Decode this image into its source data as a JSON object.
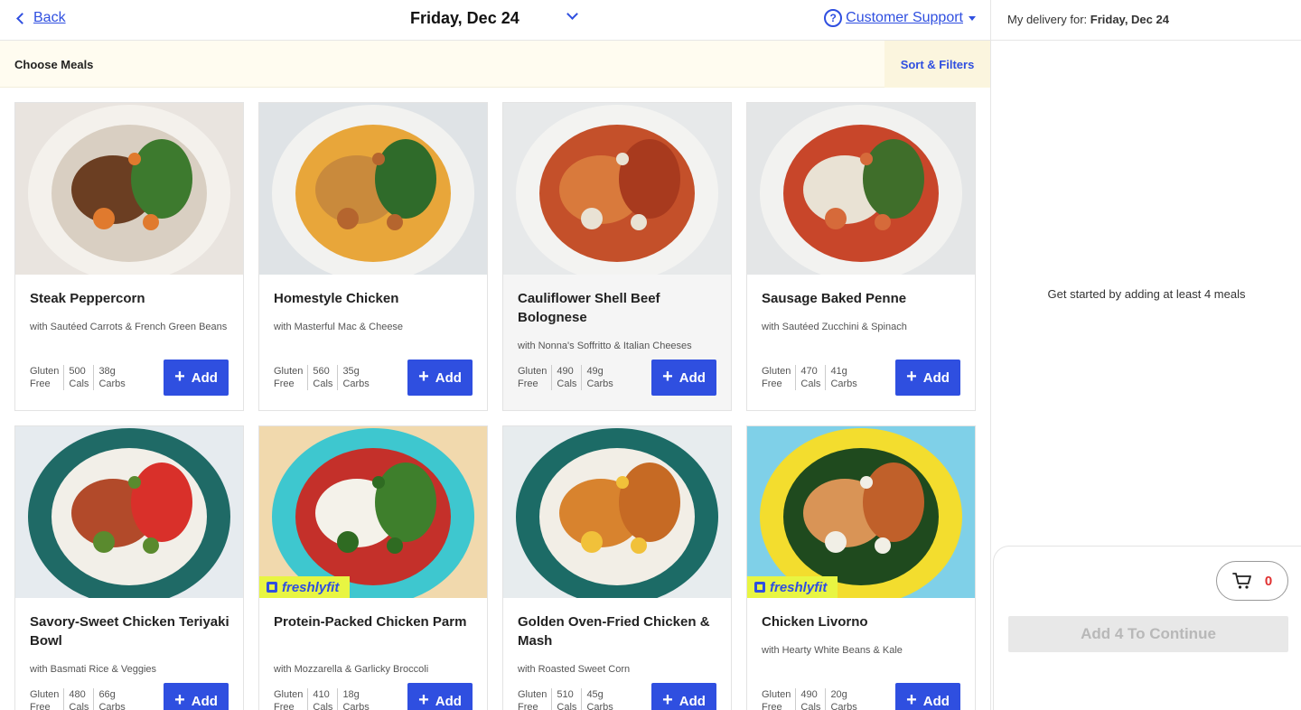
{
  "header": {
    "back_label": "Back",
    "date_label": "Friday, Dec 24",
    "support_label": "Customer Support",
    "support_icon": "?"
  },
  "subbar": {
    "title": "Choose Meals",
    "sort_label": "Sort & Filters"
  },
  "meals": [
    {
      "name": "Steak Peppercorn",
      "sub": "with Sautéed Carrots & French Green Beans",
      "diet": [
        "Gluten",
        "Free"
      ],
      "cals": [
        "500",
        "Cals"
      ],
      "carbs": [
        "38g",
        "Carbs"
      ],
      "add_label": "Add",
      "badge": ""
    },
    {
      "name": "Homestyle Chicken",
      "sub": "with Masterful Mac & Cheese",
      "diet": [
        "Gluten",
        "Free"
      ],
      "cals": [
        "560",
        "Cals"
      ],
      "carbs": [
        "35g",
        "Carbs"
      ],
      "add_label": "Add",
      "badge": ""
    },
    {
      "name": "Cauliflower Shell Beef Bolognese",
      "sub": "with Nonna's Soffritto & Italian Cheeses",
      "diet": [
        "Gluten",
        "Free"
      ],
      "cals": [
        "490",
        "Cals"
      ],
      "carbs": [
        "49g",
        "Carbs"
      ],
      "add_label": "Add",
      "badge": ""
    },
    {
      "name": "Sausage Baked Penne",
      "sub": "with Sautéed Zucchini & Spinach",
      "diet": [
        "Gluten",
        "Free"
      ],
      "cals": [
        "470",
        "Cals"
      ],
      "carbs": [
        "41g",
        "Carbs"
      ],
      "add_label": "Add",
      "badge": ""
    },
    {
      "name": "Savory-Sweet Chicken Teriyaki Bowl",
      "sub": "with Basmati Rice & Veggies",
      "diet": [
        "Gluten",
        "Free"
      ],
      "cals": [
        "480",
        "Cals"
      ],
      "carbs": [
        "66g",
        "Carbs"
      ],
      "add_label": "Add",
      "badge": ""
    },
    {
      "name": "Protein-Packed Chicken Parm",
      "sub": "with Mozzarella & Garlicky Broccoli",
      "diet": [
        "Gluten",
        "Free"
      ],
      "cals": [
        "410",
        "Cals"
      ],
      "carbs": [
        "18g",
        "Carbs"
      ],
      "add_label": "Add",
      "badge": "freshlyfit"
    },
    {
      "name": "Golden Oven-Fried Chicken & Mash",
      "sub": "with Roasted Sweet Corn",
      "diet": [
        "Gluten",
        "Free"
      ],
      "cals": [
        "510",
        "Cals"
      ],
      "carbs": [
        "45g",
        "Carbs"
      ],
      "add_label": "Add",
      "badge": ""
    },
    {
      "name": "Chicken Livorno",
      "sub": "with Hearty White Beans & Kale",
      "diet": [
        "Gluten",
        "Free"
      ],
      "cals": [
        "490",
        "Cals"
      ],
      "carbs": [
        "20g",
        "Carbs"
      ],
      "add_label": "Add",
      "badge": "freshlyfit"
    }
  ],
  "sidebar": {
    "delivery_prefix": "My delivery for:",
    "delivery_date": "Friday, Dec 24",
    "empty_message": "Get started by adding at least 4 meals",
    "cart_count": "0",
    "continue_label": "Add 4 To Continue"
  },
  "colors": {
    "accent": "#2f4fe0",
    "badge_bg": "#e8f542",
    "cart_count": "#e03030"
  }
}
